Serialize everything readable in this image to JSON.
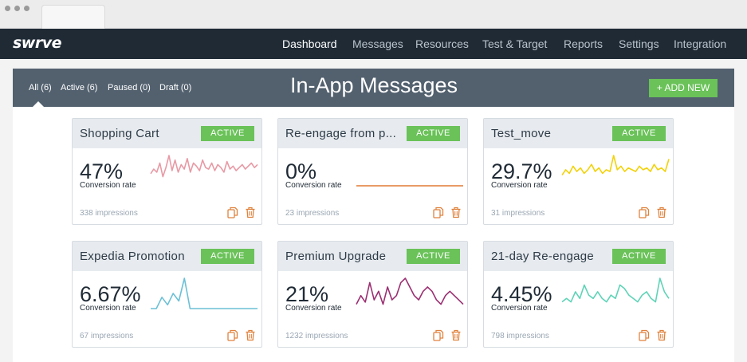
{
  "app": {
    "logo": "swrve",
    "nav": [
      {
        "label": "Dashboard",
        "active": true
      },
      {
        "label": "Messages",
        "active": false
      },
      {
        "label": "Resources",
        "active": false
      },
      {
        "label": "Test & Target",
        "active": false
      },
      {
        "label": "Reports",
        "active": false
      },
      {
        "label": "Settings",
        "active": false
      },
      {
        "label": "Integration",
        "active": false
      }
    ]
  },
  "page": {
    "title": "In-App Messages",
    "add_label": "+ ADD NEW",
    "filters": [
      {
        "label": "All (6)",
        "selected": true
      },
      {
        "label": "Active (6)",
        "selected": false
      },
      {
        "label": "Paused (0)",
        "selected": false
      },
      {
        "label": "Draft (0)",
        "selected": false
      }
    ]
  },
  "cards": [
    {
      "name": "Shopping Cart",
      "status": "ACTIVE",
      "rate": "47%",
      "rate_label": "Conversion rate",
      "impressions": "338 impressions",
      "color": "#e79aa5",
      "trend": [
        16,
        22,
        18,
        30,
        12,
        24,
        40,
        20,
        34,
        18,
        28,
        22,
        36,
        18,
        30,
        26,
        20,
        34,
        24,
        22,
        30,
        20,
        28,
        24,
        18,
        32,
        22,
        26,
        20,
        24,
        28,
        22,
        26,
        30,
        24,
        28
      ]
    },
    {
      "name": "Re-engage from p...",
      "status": "ACTIVE",
      "rate": "0%",
      "rate_label": "Conversion rate",
      "impressions": "23 impressions",
      "color": "#e07a33",
      "trend": [
        0,
        0,
        0,
        0,
        0,
        0,
        0,
        0,
        0,
        0
      ]
    },
    {
      "name": "Test_move",
      "status": "ACTIVE",
      "rate": "29.7%",
      "rate_label": "Conversion rate",
      "impressions": "31 impressions",
      "color": "#f2d20b",
      "trend": [
        12,
        18,
        14,
        22,
        16,
        20,
        14,
        18,
        24,
        16,
        20,
        14,
        18,
        16,
        34,
        18,
        22,
        16,
        20,
        18,
        16,
        22,
        18,
        20,
        16,
        24,
        18,
        20,
        16,
        30
      ]
    },
    {
      "name": "Expedia Promotion",
      "status": "ACTIVE",
      "rate": "6.67%",
      "rate_label": "Conversion rate",
      "impressions": "67 impressions",
      "color": "#6cc0d6",
      "trend": [
        0,
        0,
        6,
        2,
        8,
        4,
        16,
        0,
        0,
        0,
        0,
        0,
        0,
        0,
        0,
        0,
        0,
        0,
        0,
        0
      ]
    },
    {
      "name": "Premium Upgrade",
      "status": "ACTIVE",
      "rate": "21%",
      "rate_label": "Conversion rate",
      "impressions": "1232 impressions",
      "color": "#9b2f72",
      "trend": [
        2,
        6,
        3,
        12,
        4,
        8,
        2,
        10,
        4,
        6,
        12,
        14,
        10,
        6,
        4,
        8,
        10,
        8,
        4,
        2,
        6,
        8,
        6,
        4,
        2
      ]
    },
    {
      "name": "21-day Re-engage",
      "status": "ACTIVE",
      "rate": "4.45%",
      "rate_label": "Conversion rate",
      "impressions": "798 impressions",
      "color": "#5fd3b7",
      "trend": [
        2,
        3,
        2,
        5,
        3,
        7,
        4,
        3,
        5,
        3,
        2,
        4,
        3,
        7,
        6,
        4,
        3,
        2,
        4,
        5,
        3,
        2,
        9,
        5,
        3
      ]
    }
  ]
}
